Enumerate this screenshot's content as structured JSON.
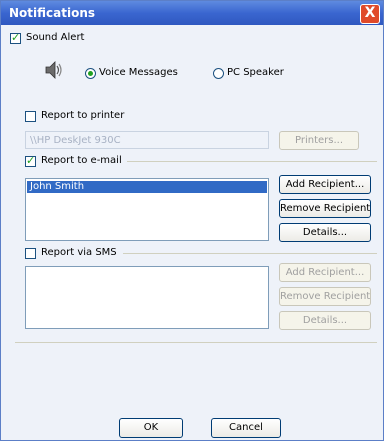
{
  "window": {
    "title": "Notifications",
    "close_glyph": "X"
  },
  "sound_alert": {
    "label": "Sound Alert",
    "checked": true,
    "icon": "speaker-icon",
    "voice_label": "Voice Messages",
    "pc_label": "PC Speaker",
    "selected": "voice"
  },
  "printer": {
    "label": "Report to printer",
    "checked": false,
    "printer_name": "\\\\HP DeskJet 930C",
    "printers_button": "Printers..."
  },
  "email": {
    "label": "Report to e-mail",
    "checked": true,
    "recipients": [
      "John Smith"
    ],
    "add_button": "Add Recipient...",
    "remove_button": "Remove Recipient",
    "details_button": "Details..."
  },
  "sms": {
    "label": "Report via SMS",
    "checked": false,
    "add_button": "Add Recipient...",
    "remove_button": "Remove Recipient",
    "details_button": "Details..."
  },
  "footer": {
    "ok": "OK",
    "cancel": "Cancel"
  }
}
